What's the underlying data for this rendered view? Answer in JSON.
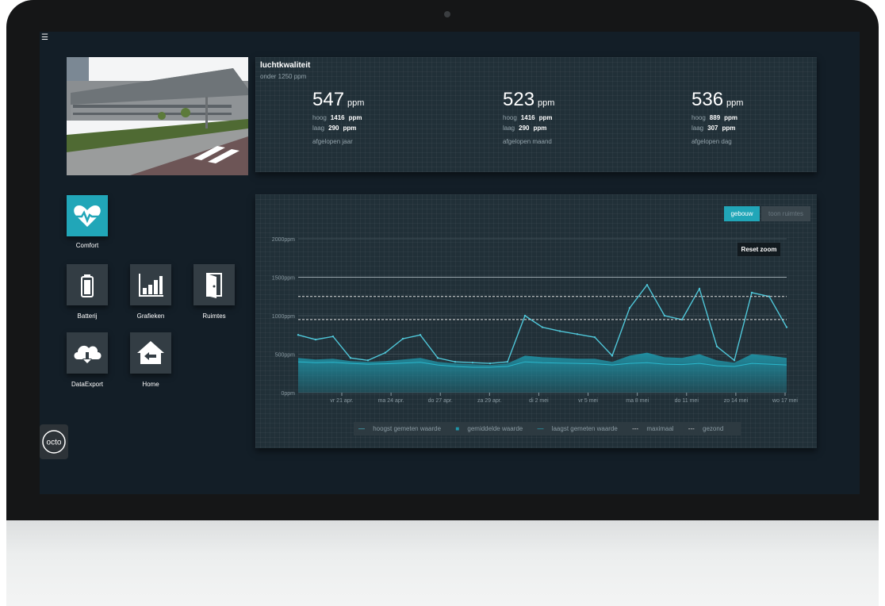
{
  "air_quality": {
    "title": "luchtkwaliteit",
    "subtitle": "onder 1250 ppm",
    "stats": [
      {
        "value": "547",
        "unit": "ppm",
        "hoog_label": "hoog",
        "hoog": "1416",
        "laag_label": "laag",
        "laag": "290",
        "period_label": "afgelopen",
        "period": "jaar"
      },
      {
        "value": "523",
        "unit": "ppm",
        "hoog_label": "hoog",
        "hoog": "1416",
        "laag_label": "laag",
        "laag": "290",
        "period_label": "afgelopen",
        "period": "maand"
      },
      {
        "value": "536",
        "unit": "ppm",
        "hoog_label": "hoog",
        "hoog": "889",
        "laag_label": "laag",
        "laag": "307",
        "period_label": "afgelopen",
        "period": "dag"
      }
    ]
  },
  "tiles": {
    "comfort": "Comfort",
    "batterij": "Batterij",
    "grafieken": "Grafieken",
    "ruimtes": "Ruimtes",
    "dataexport": "DataExport",
    "home": "Home"
  },
  "logo": {
    "text": "octo"
  },
  "chart_controls": {
    "gebouw": "gebouw",
    "toon_ruimtes": "toon ruimtes",
    "reset_zoom": "Reset zoom"
  },
  "chart_data": {
    "type": "area",
    "title": "",
    "xlabel": "",
    "ylabel": "",
    "ylim": [
      0,
      2000
    ],
    "yticks": [
      "0ppm",
      "500ppm",
      "1000ppm",
      "1500ppm",
      "2000ppm"
    ],
    "x_ticks": [
      "vr 21 apr.",
      "ma 24 apr.",
      "do 27 apr.",
      "za 29 apr.",
      "di 2 mei",
      "vr 5 mei",
      "ma 8 mei",
      "do 11 mei",
      "zo 14 mei",
      "wo 17 mei"
    ],
    "x": [
      "19 apr.",
      "20 apr.",
      "21 apr.",
      "22 apr.",
      "23 apr.",
      "24 apr.",
      "25 apr.",
      "26 apr.",
      "27 apr.",
      "28 apr.",
      "29 apr.",
      "30 apr.",
      "1 mei",
      "2 mei",
      "3 mei",
      "4 mei",
      "5 mei",
      "6 mei",
      "7 mei",
      "8 mei",
      "9 mei",
      "10 mei",
      "11 mei",
      "12 mei",
      "13 mei",
      "14 mei",
      "15 mei",
      "16 mei",
      "17 mei"
    ],
    "series": [
      {
        "name": "hoogst gemeten waarde",
        "values": [
          750,
          690,
          730,
          450,
          420,
          520,
          700,
          750,
          450,
          400,
          390,
          380,
          400,
          1000,
          850,
          800,
          760,
          720,
          480,
          1100,
          1400,
          1000,
          950,
          1350,
          600,
          420,
          1300,
          1250,
          850
        ]
      },
      {
        "name": "gemiddelde waarde",
        "values": [
          450,
          430,
          440,
          410,
          400,
          410,
          430,
          450,
          400,
          380,
          370,
          360,
          380,
          480,
          460,
          450,
          440,
          440,
          400,
          480,
          520,
          460,
          450,
          500,
          420,
          390,
          500,
          480,
          450
        ]
      },
      {
        "name": "laagst gemeten waarde",
        "values": [
          400,
          390,
          395,
          380,
          370,
          375,
          385,
          395,
          360,
          340,
          330,
          330,
          340,
          400,
          390,
          385,
          380,
          375,
          360,
          380,
          390,
          370,
          365,
          380,
          350,
          340,
          380,
          370,
          360
        ]
      },
      {
        "name": "maximaal",
        "values": [
          1250,
          1250,
          1250,
          1250,
          1250,
          1250,
          1250,
          1250,
          1250,
          1250,
          1250,
          1250,
          1250,
          1250,
          1250,
          1250,
          1250,
          1250,
          1250,
          1250,
          1250,
          1250,
          1250,
          1250,
          1250,
          1250,
          1250,
          1250,
          1250
        ]
      },
      {
        "name": "gezond",
        "values": [
          950,
          950,
          950,
          950,
          950,
          950,
          950,
          950,
          950,
          950,
          950,
          950,
          950,
          950,
          950,
          950,
          950,
          950,
          950,
          950,
          950,
          950,
          950,
          950,
          950,
          950,
          950,
          950,
          950
        ]
      }
    ],
    "reference_line": 1500,
    "grid": true,
    "legend_position": "bottom",
    "colors": {
      "max": "#4fc6d8",
      "avg": "#1f97ab",
      "min": "#2ab7cc",
      "dash": "#dddddd",
      "grid": "#3d4c54",
      "axis_text": "#8a9aa2"
    }
  }
}
